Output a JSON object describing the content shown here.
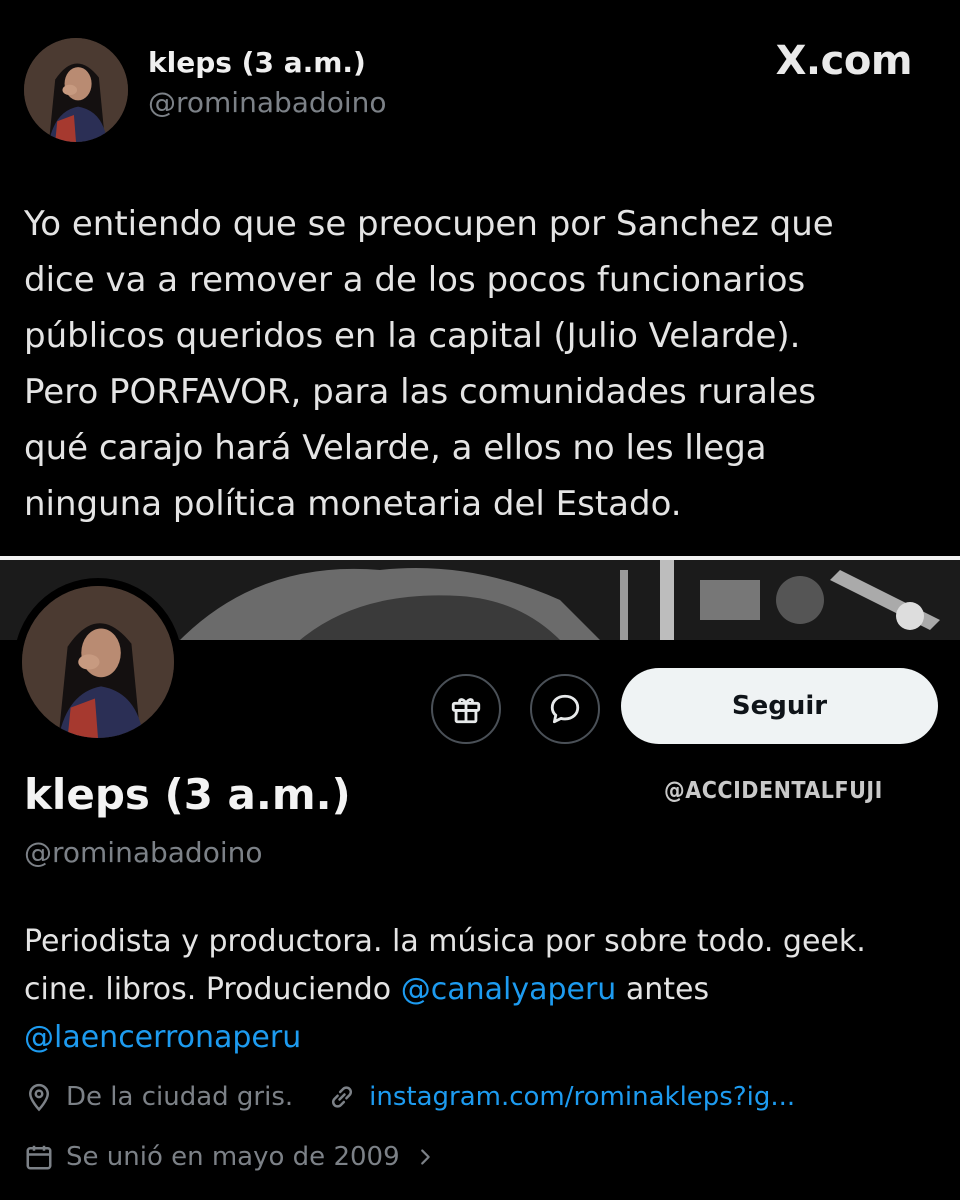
{
  "tweet": {
    "display_name": "kleps (3 a.m.)",
    "handle": "@rominabadoino",
    "site_logo": "X.com",
    "text_lines": [
      "Yo entiendo que se preocupen por Sanchez que",
      "dice va a remover a de los pocos funcionarios",
      "públicos queridos en la capital (Julio Velarde).",
      "Pero PORFAVOR, para las comunidades rurales",
      "qué carajo hará Velarde, a ellos no les llega",
      "ninguna política monetaria del Estado."
    ]
  },
  "profile": {
    "display_name": "kleps (3 a.m.)",
    "handle": "@rominabadoino",
    "follow_label": "Seguir",
    "watermark": "@ACCIDENTALFUJI",
    "bio": {
      "part1": "Periodista y productora. la música por sobre todo. geek.",
      "part2": "cine. libros. Produciendo ",
      "mention1": "@canalyaperu",
      "part3": " antes",
      "mention2": "@laencerronaperu"
    },
    "location": "De la ciudad gris.",
    "website": "instagram.com/rominakleps?ig...",
    "joined": "Se unió en mayo de 2009",
    "icons": {
      "gift": "gift-icon",
      "message": "message-icon",
      "location": "location-pin-icon",
      "link": "link-icon",
      "calendar": "calendar-icon",
      "chevron": "chevron-right-icon"
    }
  },
  "colors": {
    "background": "#000000",
    "text": "#e7e9ea",
    "secondary": "#7c8187",
    "accent": "#1d9bf0",
    "button_bg": "#eff3f4"
  }
}
